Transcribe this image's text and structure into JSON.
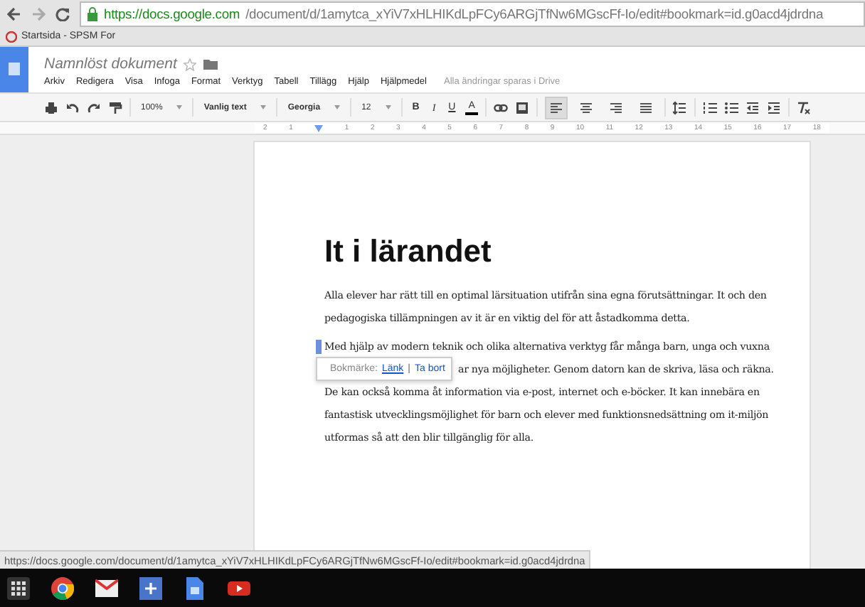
{
  "browser": {
    "url_host": "https://docs.google.com",
    "url_path": "/document/d/1amytca_xYiV7xHLHIKdLpFCy6ARGjTfNw6MGscFf-Io/edit#bookmark=id.g0acd4jdrdna",
    "bookmarks": [
      {
        "label": "Startsida - SPSM For"
      }
    ]
  },
  "document": {
    "title": "Namnlöst dokument",
    "starred": false,
    "save_status": "Alla ändringar sparas i Drive"
  },
  "menu": [
    "Arkiv",
    "Redigera",
    "Visa",
    "Infoga",
    "Format",
    "Verktyg",
    "Tabell",
    "Tillägg",
    "Hjälp",
    "Hjälpmedel"
  ],
  "toolbar": [
    {
      "kind": "icon"
    },
    {
      "kind": "icon"
    },
    {
      "kind": "icon"
    },
    {
      "kind": "icon"
    },
    {
      "kind": "sep"
    },
    {
      "kind": "dropdown",
      "label": "100%",
      "bold": false
    },
    {
      "kind": "sep"
    },
    {
      "kind": "dropdown",
      "label": "Vanlig text",
      "bold": true
    },
    {
      "kind": "sep"
    },
    {
      "kind": "dropdown",
      "label": "Georgia",
      "bold": true
    },
    {
      "kind": "sep"
    },
    {
      "kind": "dropdown",
      "label": "12",
      "bold": false
    },
    {
      "kind": "sep"
    },
    {
      "kind": "text",
      "label": "B"
    },
    {
      "kind": "text",
      "label": "I"
    },
    {
      "kind": "text",
      "label": "U"
    },
    {
      "kind": "text",
      "label": "A"
    },
    {
      "kind": "sep"
    },
    {
      "kind": "icon"
    },
    {
      "kind": "icon"
    },
    {
      "kind": "sep"
    },
    {
      "kind": "align",
      "selected": true
    },
    {
      "kind": "align",
      "selected": false
    },
    {
      "kind": "align",
      "selected": false
    },
    {
      "kind": "align",
      "selected": false
    },
    {
      "kind": "sep"
    },
    {
      "kind": "icon"
    },
    {
      "kind": "sep"
    },
    {
      "kind": "icon"
    },
    {
      "kind": "icon"
    },
    {
      "kind": "icon"
    },
    {
      "kind": "icon"
    },
    {
      "kind": "sep"
    },
    {
      "kind": "icon"
    }
  ],
  "ruler": [
    "2",
    "1",
    "1",
    "2",
    "3",
    "4",
    "5",
    "6",
    "7",
    "8",
    "9",
    "10",
    "11",
    "12",
    "13",
    "14",
    "15",
    "16",
    "17",
    "18"
  ],
  "page": {
    "heading": "It i lärandet",
    "paragraphs": [
      {
        "lines": [
          "Alla elever har rätt  till en optimal lärsituation utifrån sina egna förutsättningar. It och den",
          "pedagogiska tillämpningen av it är en viktig del för att åstadkomma detta."
        ]
      },
      {
        "bookmarked": true,
        "lines": [
          "Med hjälp av modern teknik och olika alternativa verktyg får många barn, unga och vuxna",
          "ar nya möjligheter. Genom datorn kan de skriva, läsa och räkna.",
          "De kan också komma åt information via e-post, internet och e-böcker. It kan innebära en",
          "fantastisk utvecklingsmöjlighet för barn och elever med funktionsnedsättning om it-miljön",
          "utformas så att den blir tillgänglig för alla."
        ]
      }
    ],
    "bookmark_popup": {
      "label": "Bokmärke:",
      "link": "Länk",
      "separator": "|",
      "remove": "Ta bort"
    }
  },
  "status_url": "https://docs.google.com/document/d/1amytca_xYiV7xHLHIKdLpFCy6ARGjTfNw6MGscFf-Io/edit#bookmark=id.g0acd4jdrdna"
}
